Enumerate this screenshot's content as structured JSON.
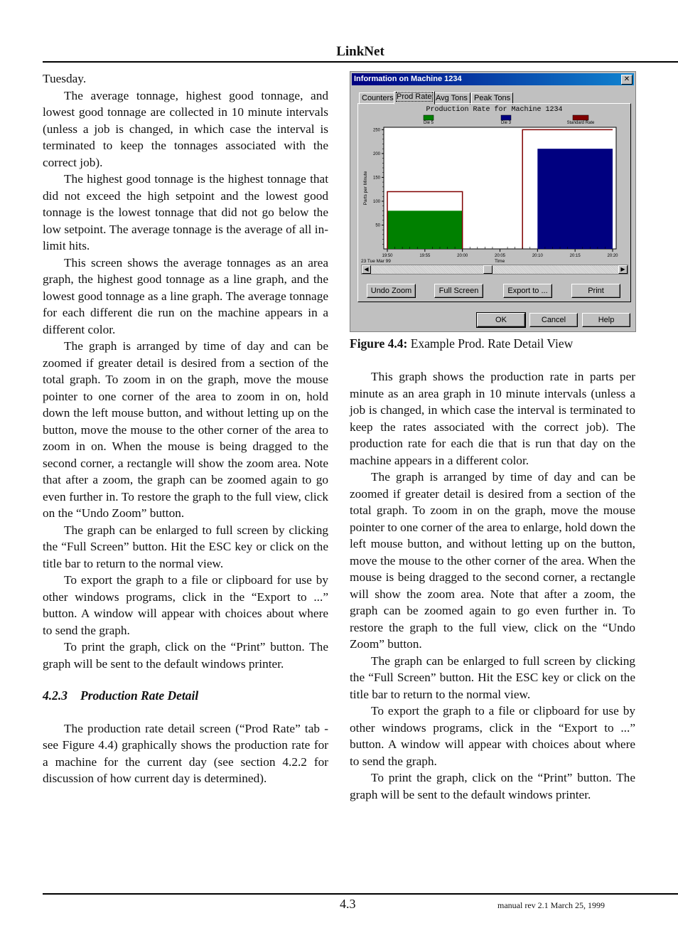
{
  "header": {
    "title": "LinkNet"
  },
  "footer": {
    "page_number": "4.3",
    "revision": "manual rev 2.1     March 25, 1999"
  },
  "left_column": {
    "p0": "Tuesday.",
    "p1": "The average tonnage, highest good tonnage, and lowest good tonnage are collected in 10 minute intervals (unless a job is changed, in which case the interval is terminated to keep the tonnages associated with the correct job).",
    "p2": "The highest good tonnage is the highest tonnage that did not exceed the high setpoint and the lowest good tonnage is the lowest tonnage that did not go below the low setpoint.  The average tonnage is the average of all in-limit hits.",
    "p3": "This screen shows the average tonnages as an area graph, the highest good tonnage as a line graph, and the lowest good tonnage as a line graph. The average tonnage for each different die run on the machine appears in a different color.",
    "p4": "The graph is arranged by time of day and can be zoomed if greater detail is desired from a section of the total graph.  To zoom in on the graph, move the mouse pointer to one corner of the area to zoom in on, hold down the left mouse button, and without letting up on the button, move the mouse to the other corner of the area to zoom in on.  When the mouse is being dragged to the second corner, a rectangle will show the zoom area.  Note that after a zoom, the graph can be zoomed again to go even further in.  To restore the graph to the full view, click on the  “Undo Zoom” button.",
    "p5": "The graph can be enlarged to full screen by clicking the “Full Screen” button.  Hit the ESC key or click on the title bar to return to the normal view.",
    "p6": "To export the graph to a file or clipboard for use by other windows programs, click in the “Export to ...” button.  A window will appear with choices about where to send the graph.",
    "p7": "To print the graph, click on the “Print” button.  The graph will be sent to the default windows printer.",
    "section_number": "4.2.3",
    "section_title": "Production Rate Detail",
    "p8": "The production rate detail screen (“Prod Rate” tab - see Figure 4.4) graphically shows the production rate for a machine for the current day (see section 4.2.2 for discussion of how current day is determined)."
  },
  "figure": {
    "caption_label": "Figure 4.4:",
    "caption_text": " Example Prod. Rate Detail View",
    "dialog": {
      "title": "Information on Machine 1234",
      "close_glyph": "✕",
      "tabs": [
        "Counters",
        "Prod Rate",
        "Avg Tons",
        "Peak Tons"
      ],
      "active_tab": "Prod Rate",
      "scroll_left_glyph": "◀",
      "scroll_right_glyph": "▶",
      "buttons": {
        "undo_zoom": "Undo Zoom",
        "full_screen": "Full Screen",
        "export": "Export to ...",
        "print": "Print",
        "ok": "OK",
        "cancel": "Cancel",
        "help": "Help"
      }
    }
  },
  "right_column": {
    "p1": "This graph shows the production rate in parts per minute as an area graph in 10 minute intervals (unless a job is changed, in which case the interval is terminated to keep the rates associated with the correct job).  The production rate for each die that is run that day on the machine appears in a different color.",
    "p2": "The graph is arranged by time of day and can be zoomed if greater detail is desired from a section of the total graph.  To zoom in on the graph, move the mouse pointer to one corner of the area to enlarge, hold down the left mouse button, and without letting up on the button, move the mouse to the other corner of the area.  When the mouse is being dragged to the second corner, a rectangle will show the zoom area.  Note that after a zoom, the graph can be zoomed again to go even further in.  To restore the graph to the full view, click on the “Undo Zoom” button.",
    "p3": "The graph can be enlarged to full screen by clicking the “Full Screen” button.  Hit the ESC key or click on the title bar to return to the normal view.",
    "p4": "To export the graph to a file or clipboard for use by other windows programs, click in the “Export to ...” button.  A window will appear with choices about where to send the graph.",
    "p5": "To print the graph, click on the “Print” button.  The graph will be sent to the default windows printer."
  },
  "chart_data": {
    "type": "area",
    "title": "Production Rate for Machine 1234",
    "xlabel": "Time",
    "ylabel": "Parts per Minute",
    "date_label": "23 Tue Mar 99",
    "x_tick_labels": [
      "19:50",
      "19:55",
      "20:00",
      "20:05",
      "20:10",
      "20:15",
      "20:20"
    ],
    "x_range_minutes": [
      0,
      30
    ],
    "y_ticks": [
      50,
      100,
      150,
      200,
      250
    ],
    "ylim": [
      0,
      255
    ],
    "legend": [
      {
        "name": "Die 5",
        "color": "#008000"
      },
      {
        "name": "Die 3",
        "color": "#000080"
      },
      {
        "name": "Standard Rate",
        "color": "#800000"
      }
    ],
    "legend_position": "top",
    "series": [
      {
        "name": "Die 5",
        "kind": "area",
        "color": "#008000",
        "segments": [
          {
            "start": "19:50",
            "end": "20:00",
            "value": 80
          }
        ]
      },
      {
        "name": "Die 3",
        "kind": "area",
        "color": "#000080",
        "segments": [
          {
            "start": "20:10",
            "end": "20:20",
            "value": 210
          }
        ]
      },
      {
        "name": "Standard Rate",
        "kind": "line",
        "color": "#800000",
        "segments": [
          {
            "start": "19:50",
            "end": "20:00",
            "value": 120
          },
          {
            "start": "20:08",
            "end": "20:20",
            "value": 250
          }
        ]
      }
    ],
    "grid": false
  }
}
